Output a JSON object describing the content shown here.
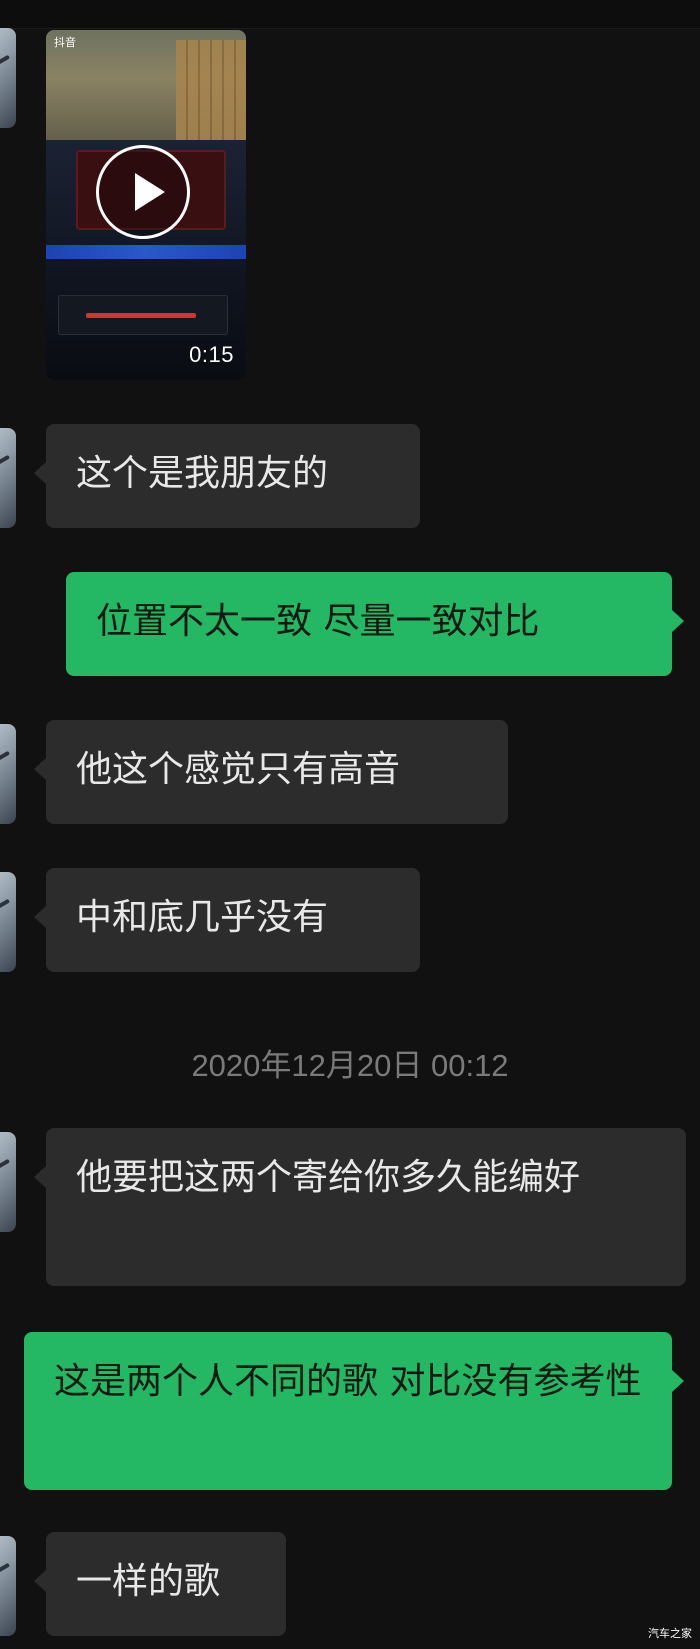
{
  "video": {
    "brand": "抖音",
    "duration": "0:15",
    "play_icon": "play-icon"
  },
  "messages": [
    {
      "direction": "in",
      "text": "这个是我朋友的"
    },
    {
      "direction": "out",
      "text": "位置不太一致 尽量一致对比"
    },
    {
      "direction": "in",
      "text": "他这个感觉只有高音"
    },
    {
      "direction": "in",
      "text": "中和底几乎没有"
    },
    {
      "direction": "in",
      "text": "他要把这两个寄给你多久能编好"
    },
    {
      "direction": "out",
      "text": "这是两个人不同的歌 对比没有参考性"
    },
    {
      "direction": "in",
      "text": "一样的歌"
    }
  ],
  "timestamp": "2020年12月20日 00:12",
  "watermark": "汽车之家",
  "colors": {
    "background": "#111111",
    "incoming_bubble": "#2c2c2c",
    "outgoing_bubble": "#25b864",
    "timestamp_text": "#7a7a7a"
  }
}
